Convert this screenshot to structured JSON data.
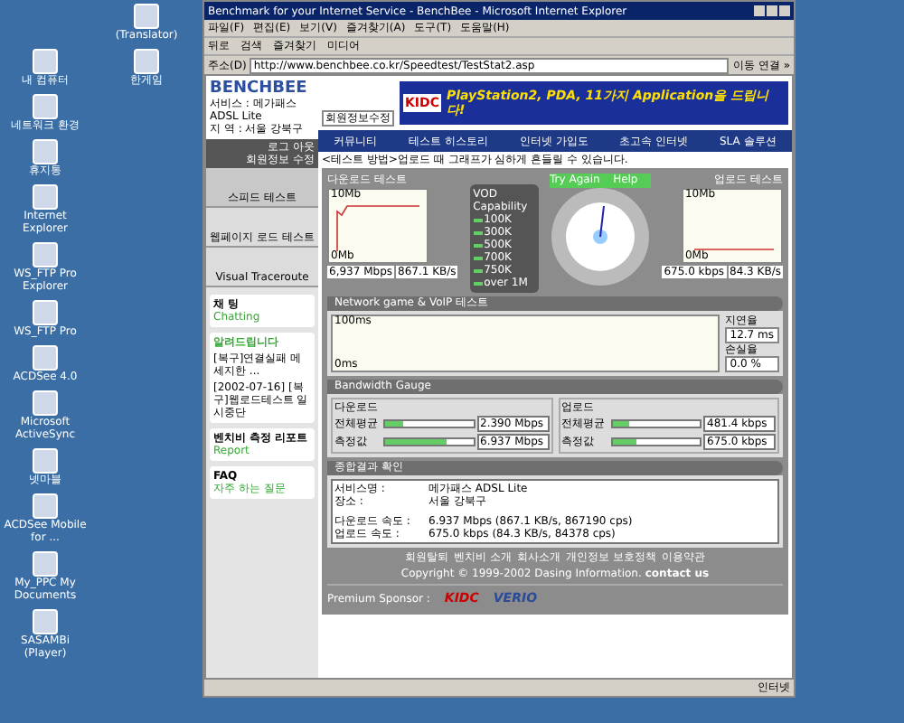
{
  "desktop": {
    "icons": [
      {
        "label": "(Translator)"
      },
      {
        "label": "내 컴퓨터"
      },
      {
        "label": "한게임"
      },
      {
        "label": "네트워크 환경"
      },
      {
        "label": "휴지통"
      },
      {
        "label": "Internet Explorer"
      },
      {
        "label": "WS_FTP Pro Explorer"
      },
      {
        "label": "WS_FTP Pro"
      },
      {
        "label": "ACDSee 4.0"
      },
      {
        "label": "Microsoft ActiveSync"
      },
      {
        "label": "넷마블"
      },
      {
        "label": "ACDSee Mobile for ..."
      },
      {
        "label": "My_PPC My Documents"
      },
      {
        "label": "SASAMBi (Player)"
      }
    ]
  },
  "window": {
    "title": "Benchmark for your Internet Service - BenchBee - Microsoft Internet Explorer",
    "menu": [
      "파일(F)",
      "편집(E)",
      "보기(V)",
      "즐겨찾기(A)",
      "도구(T)",
      "도움말(H)"
    ],
    "toolbar": [
      "뒤로",
      "검색",
      "즐겨찾기",
      "미디어"
    ],
    "address": {
      "label": "주소(D)",
      "value": "http://www.benchbee.co.kr/Speedtest/TestStat2.asp",
      "go": "이동",
      "links": "연결 »"
    },
    "status_bar": "인터넷"
  },
  "page": {
    "logo": "BENCHBEE",
    "service": "서비스 : 메가패스 ADSL Lite",
    "region": "지 역 : 서울 강북구",
    "member_button": "회원정보수정",
    "account_links": [
      "로그 아웃",
      "회원정보 수정"
    ],
    "banner": {
      "brand": "KIDC",
      "text": "PlayStation2, PDA, 11가지 Application을 드립니다!"
    },
    "nav": [
      "커뮤니티",
      "테스트 히스토리",
      "인터넷 가입도",
      "초고속 인터넷",
      "SLA 솔루션"
    ],
    "side_menu": [
      {
        "label": "스피드 테스트",
        "selected": true
      },
      {
        "label": "웹페이지 로드 테스트",
        "selected": false
      },
      {
        "label": "Visual Traceroute",
        "selected": false
      }
    ],
    "chat": {
      "title": "채 팅",
      "subtitle": "Chatting"
    },
    "notices": {
      "title": "알려드립니다",
      "items": [
        "[복구]연결실패 메세지한 ...",
        "[2002-07-16] [복구]웹로드테스트 일시중단"
      ]
    },
    "report": {
      "title": "벤치비 측정 리포트",
      "subtitle": "Report"
    },
    "faq": {
      "title": "FAQ",
      "subtitle": "자주 하는 질문"
    },
    "notice_line": "<테스트 방법>업로드 때 그래프가 심하게 흔들릴 수 있습니다.",
    "download": {
      "title": "다운로드 테스트",
      "top": "10Mb",
      "bottom": "0Mb",
      "speed": "6,937 Mbps",
      "rate": "867.1 KB/s"
    },
    "upload": {
      "title": "업로드 테스트",
      "top": "10Mb",
      "bottom": "0Mb",
      "speed": "675.0 kbps",
      "rate": "84.3 KB/s"
    },
    "vod": {
      "title": "VOD Capability",
      "levels": [
        {
          "label": "100K",
          "on": true
        },
        {
          "label": "300K",
          "on": true
        },
        {
          "label": "500K",
          "on": true
        },
        {
          "label": "700K",
          "on": true
        },
        {
          "label": "750K",
          "on": true
        },
        {
          "label": "over 1M",
          "on": true
        }
      ]
    },
    "gauge": {
      "try_again": "Try Again",
      "help": "Help"
    },
    "network": {
      "title": "Network game & VoIP 테스트",
      "top": "100ms",
      "bottom": "0ms",
      "latency_label": "지연율",
      "latency": "12.7 ms",
      "loss_label": "손실율",
      "loss": "0.0 %"
    },
    "bandwidth": {
      "title": "Bandwidth Gauge",
      "groups": [
        {
          "name": "다운로드",
          "rows": [
            {
              "label": "전체평균",
              "level": 0.2,
              "value": "2.390 Mbps"
            },
            {
              "label": "측정값",
              "level": 0.7,
              "value": "6.937 Mbps"
            }
          ]
        },
        {
          "name": "업로드",
          "rows": [
            {
              "label": "전체평균",
              "level": 0.2,
              "value": "481.4 kbps"
            },
            {
              "label": "측정값",
              "level": 0.27,
              "value": "675.0 kbps"
            }
          ]
        }
      ]
    },
    "summary": {
      "title": "종합결과 확인",
      "lines": [
        {
          "key": "서비스명 :",
          "value": "메가패스 ADSL Lite"
        },
        {
          "key": "장소 :",
          "value": "서울 강북구"
        },
        {
          "key": "다운로드 속도 :",
          "value": "6.937 Mbps (867.1 KB/s, 867190 cps)"
        },
        {
          "key": "업로드 속도 :",
          "value": "675.0 kbps (84.3 KB/s, 84378 cps)"
        }
      ]
    },
    "footer_links": [
      "회원탈퇴",
      "벤치비 소개",
      "회사소개",
      "개인정보 보호정책",
      "이용약관"
    ],
    "copyright": "Copyright © 1999-2002 Dasing Information.",
    "contact": "contact us",
    "sponsor_label": "Premium Sponsor :",
    "sponsors": [
      "KIDC",
      "VERIO"
    ]
  }
}
